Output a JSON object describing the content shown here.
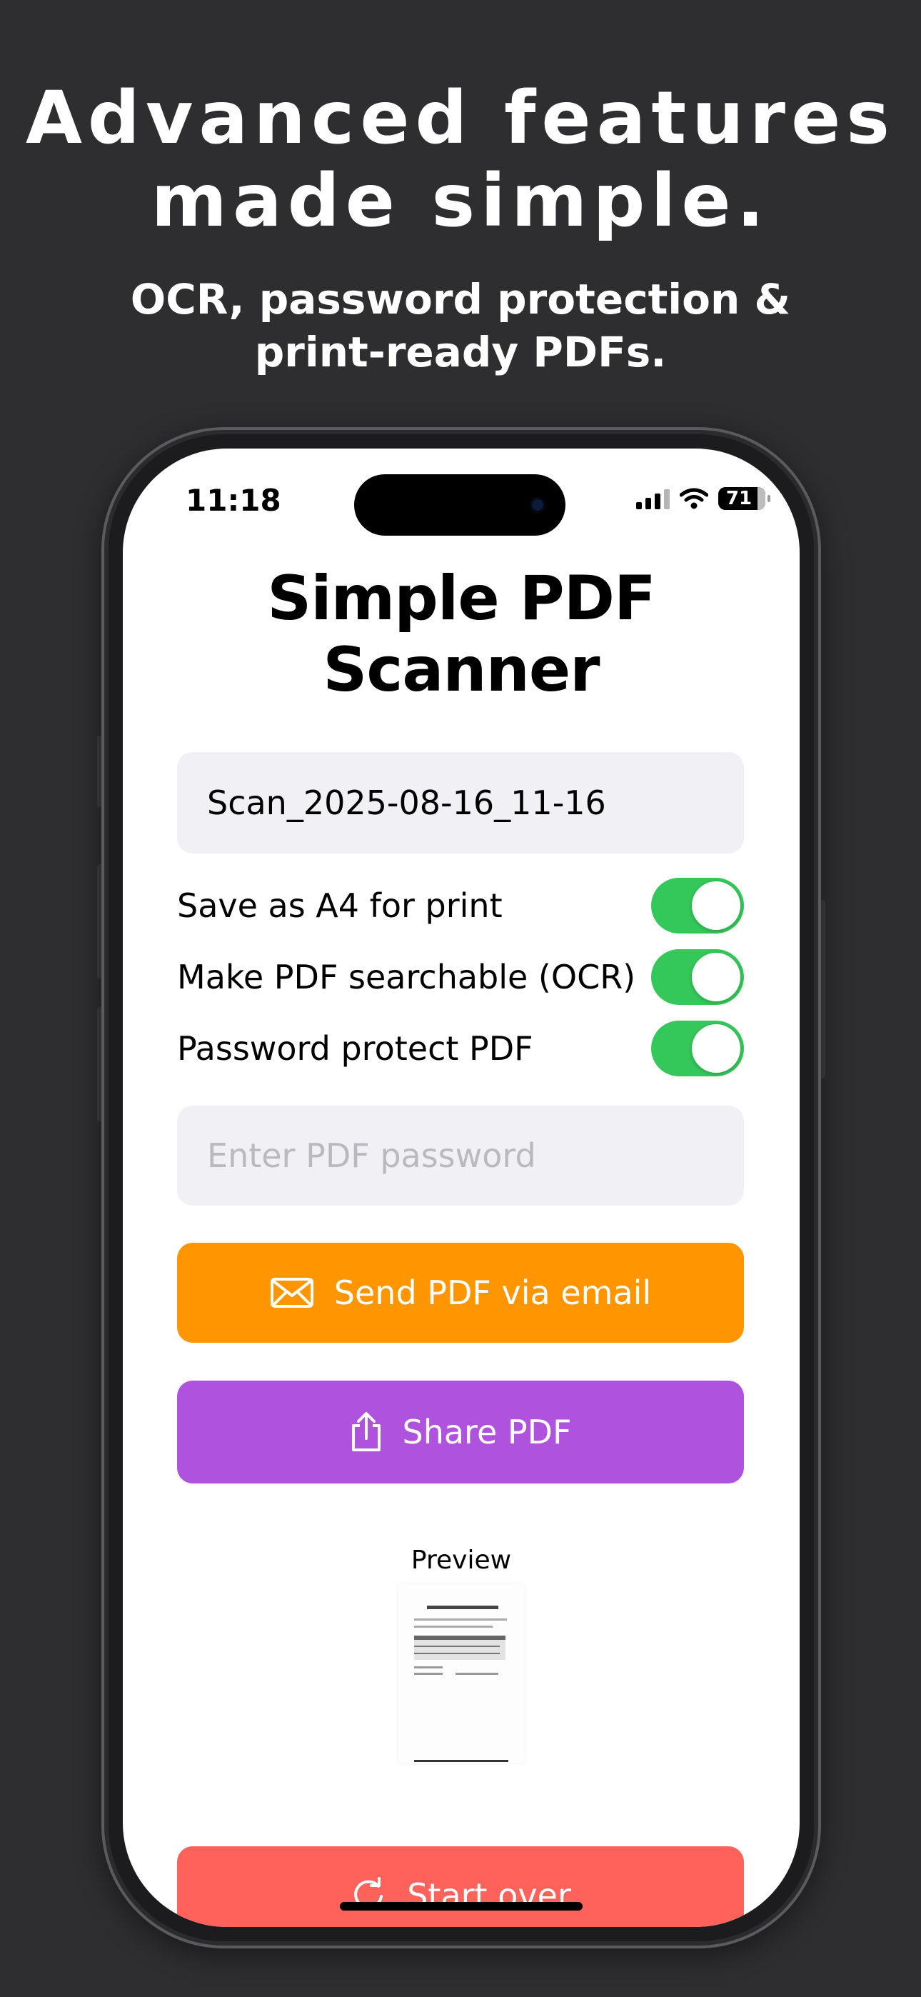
{
  "marketing": {
    "headline_line1": "Advanced features",
    "headline_line2": "made simple.",
    "subheadline_line1": "OCR, password protection &",
    "subheadline_line2": "print-ready PDFs."
  },
  "status_bar": {
    "time": "11:18",
    "battery": "71"
  },
  "app": {
    "title": "Simple PDF Scanner",
    "filename_value": "Scan_2025-08-16_11-16",
    "toggles": [
      {
        "label": "Save as A4 for print",
        "on": true
      },
      {
        "label": "Make PDF searchable (OCR)",
        "on": true
      },
      {
        "label": "Password protect PDF",
        "on": true
      }
    ],
    "password_placeholder": "Enter PDF password",
    "email_button": "Send PDF via email",
    "share_button": "Share PDF",
    "preview_label": "Preview",
    "start_over_button": "Start over"
  },
  "colors": {
    "background": "#2e2e30",
    "toggle_on": "#34c759",
    "email_button": "#ff9500",
    "share_button": "#af52de",
    "start_over_button": "#ff625a"
  },
  "icons": {
    "email": "envelope-icon",
    "share": "share-icon",
    "start_over": "refresh-icon"
  }
}
